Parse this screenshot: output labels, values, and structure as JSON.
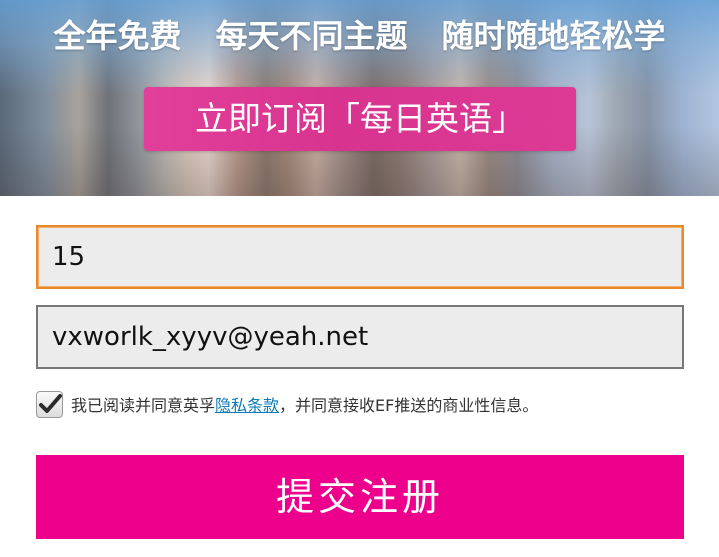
{
  "banner": {
    "headline_parts": [
      "全年免费",
      "每天不同主题",
      "随时随地轻松学"
    ],
    "subscribe_label": "立即订阅「每日英语」"
  },
  "form": {
    "field_1_value": "15",
    "field_2_value": "vxworlk_xyyv@yeah.net",
    "agree": {
      "checked": true,
      "text_before": "我已阅读并同意英孚",
      "link_text": "隐私条款",
      "text_after": "，并同意接收EF推送的商业性信息。"
    },
    "submit_label": "提交注册"
  },
  "colors": {
    "accent": "#ec008c",
    "subscribe_button": "#dc3a95",
    "focus_border": "#e8892a",
    "link": "#0a7ab8"
  },
  "icons": {
    "checkbox": "checkmark-icon"
  }
}
